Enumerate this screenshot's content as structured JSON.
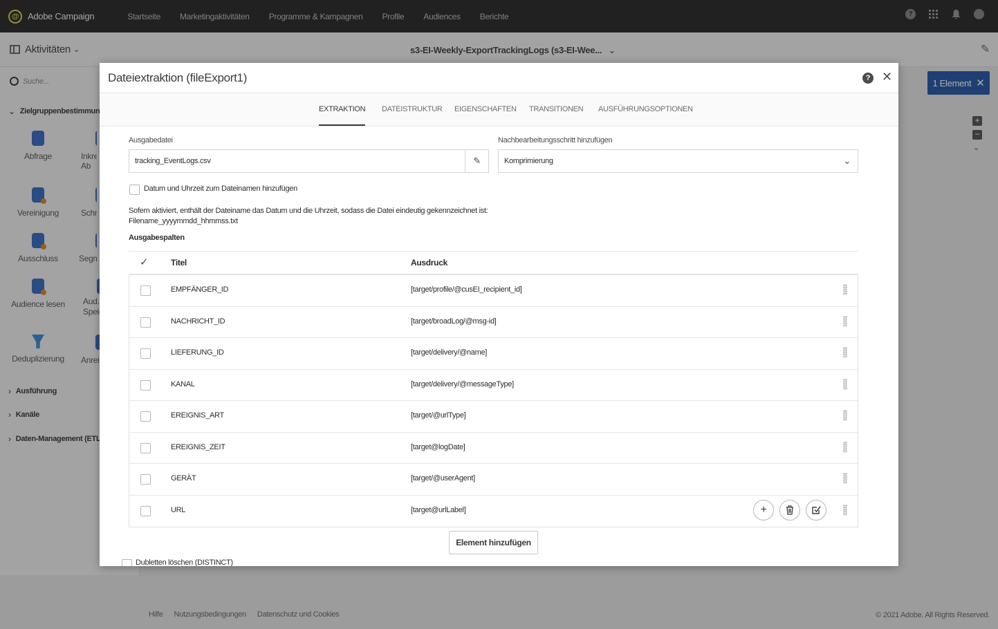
{
  "app": {
    "name": "Adobe Campaign",
    "nav": [
      "Startseite",
      "Marketingaktivitäten",
      "Programme & Kampagnen",
      "Profile",
      "Audiences",
      "Berichte"
    ]
  },
  "subbar": {
    "activities_label": "Aktivitäten",
    "workflow_title": "s3-EI-Weekly-ExportTrackingLogs (s3-EI-Wee..."
  },
  "palette": {
    "search_placeholder": "Suche...",
    "section_targeting": "Zielgruppenbestimmung",
    "activities": [
      {
        "label": "Abfrage"
      },
      {
        "label": "Inkrem. Ab"
      },
      {
        "label": "Vereinigung"
      },
      {
        "label": "Schnit"
      },
      {
        "label": "Ausschluss"
      },
      {
        "label": "Segme"
      },
      {
        "label": "Audience lesen"
      },
      {
        "label": "Aud. Speic"
      },
      {
        "label": "Deduplizierung"
      },
      {
        "label": "Anrei"
      }
    ],
    "sections_collapsed": [
      "Ausführung",
      "Kanäle",
      "Daten-Management (ETL)"
    ]
  },
  "canvas": {
    "element_button": "1 Element"
  },
  "footer": {
    "links": [
      "Hilfe",
      "Nutzungsbedingungen",
      "Datenschutz und Cookies"
    ],
    "copyright": "© 2021 Adobe. All Rights Reserved."
  },
  "modal": {
    "title": "Dateiextraktion (fileExport1)",
    "tabs": [
      "EXTRAKTION",
      "DATEISTRUKTUR",
      "EIGENSCHAFTEN",
      "TRANSITIONEN",
      "AUSFÜHRUNGSOPTIONEN"
    ],
    "output_file_label": "Ausgabedatei",
    "output_file_value": "tracking_EventLogs.csv",
    "postprocess_label": "Nachbearbeitungsschritt hinzufügen",
    "postprocess_value": "Komprimierung",
    "datetime_checkbox_label": "Datum und Uhrzeit zum Dateinamen hinzufügen",
    "info_line1": "Sofern aktiviert, enthält der Dateiname das Datum und die Uhrzeit, sodass die Datei eindeutig gekennzeichnet ist:",
    "info_line2": "Filename_yyyymmdd_hhmmss.txt",
    "columns_title": "Ausgabespalten",
    "col_title": "Titel",
    "col_expression": "Ausdruck",
    "rows": [
      {
        "title": "EMPFÄNGER_ID",
        "expr": "[target/profile/@cusEI_recipient_id]"
      },
      {
        "title": "NACHRICHT_ID",
        "expr": "[target/broadLog/@msg-id]"
      },
      {
        "title": "LIEFERUNG_ID",
        "expr": "[target/delivery/@name]"
      },
      {
        "title": "KANAL",
        "expr": "[target/delivery/@messageType]"
      },
      {
        "title": "EREIGNIS_ART",
        "expr": "[target/@urlType]"
      },
      {
        "title": "EREIGNIS_ZEIT",
        "expr": "[target@logDate]"
      },
      {
        "title": "GERÄT",
        "expr": "[target/@userAgent]"
      },
      {
        "title": "URL",
        "expr": "[target@urlLabel]"
      }
    ],
    "add_element_label": "Element hinzufügen",
    "distinct_label": "Dubletten löschen (DISTINCT)"
  },
  "colors": {
    "topbar": "#323232",
    "accent": "#2e5ea8",
    "logo": "#d7d25a"
  }
}
